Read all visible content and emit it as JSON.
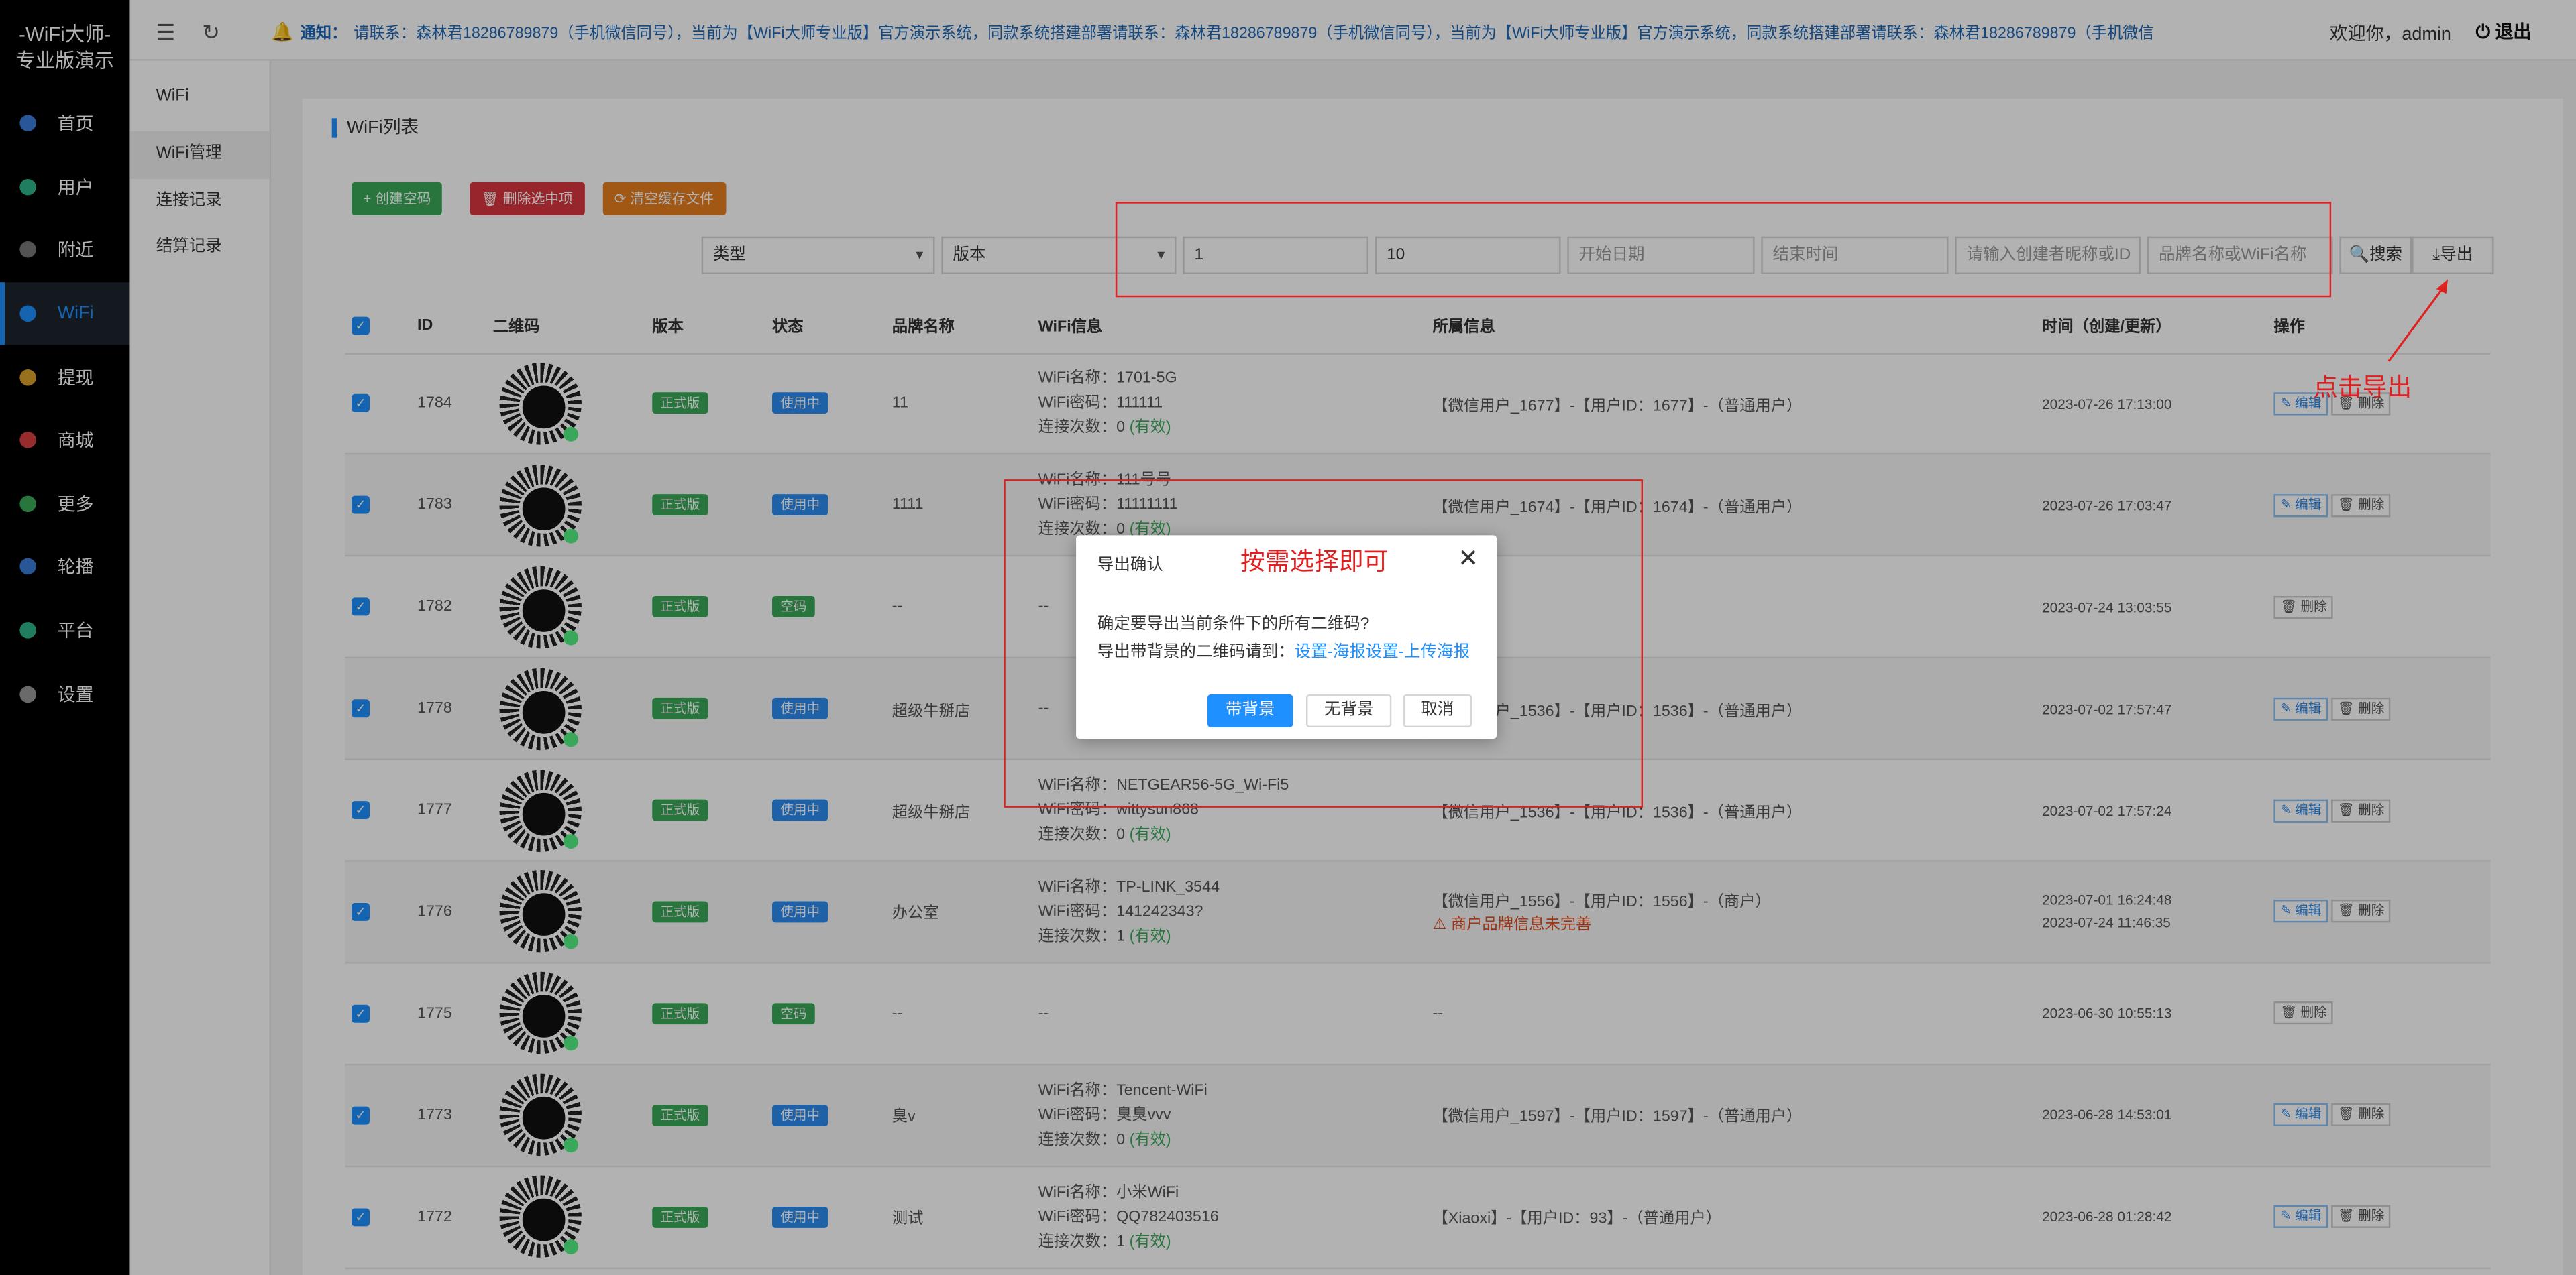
{
  "brand": {
    "line1": "-WiFi大师-",
    "line2": "专业版演示"
  },
  "sidebar": {
    "items": [
      {
        "label": "首页",
        "icon": "home-icon",
        "color": "#3b7bd8"
      },
      {
        "label": "用户",
        "icon": "user-icon",
        "color": "#2fb38a"
      },
      {
        "label": "附近",
        "icon": "location-icon",
        "color": "#777777"
      },
      {
        "label": "WiFi",
        "icon": "wifi-icon",
        "color": "#1e90ff"
      },
      {
        "label": "提现",
        "icon": "coin-icon",
        "color": "#d9a32a"
      },
      {
        "label": "商城",
        "icon": "shop-icon",
        "color": "#d94040"
      },
      {
        "label": "更多",
        "icon": "more-icon",
        "color": "#3aa85a"
      },
      {
        "label": "轮播",
        "icon": "carousel-icon",
        "color": "#3b7bd8"
      },
      {
        "label": "平台",
        "icon": "platform-icon",
        "color": "#2fb38a"
      },
      {
        "label": "设置",
        "icon": "settings-icon",
        "color": "#999999"
      }
    ]
  },
  "submenu": {
    "title": "WiFi",
    "items": [
      "WiFi管理",
      "连接记录",
      "结算记录"
    ]
  },
  "topbar": {
    "notice_label": "通知：",
    "notice_text": "请联系：森林君18286789879（手机微信同号），当前为【WiFi大师专业版】官方演示系统，同款系统搭建部署请联系：森林君18286789879（手机微信同号），当前为【WiFi大师专业版】官方演示系统，同款系统搭建部署请联系：森林君18286789879（手机微信",
    "welcome": "欢迎你，admin",
    "logout": "退出"
  },
  "page": {
    "title": "WiFi列表"
  },
  "toolbar": {
    "create": "创建空码",
    "delete": "删除选中项",
    "clear": "清空缓存文件"
  },
  "filters": {
    "type": "类型",
    "version": "版本",
    "page": "1",
    "size": "10",
    "start_date": "开始日期",
    "end_date": "结束时间",
    "creator": "请输入创建者昵称或ID",
    "brand": "品牌名称或WiFi名称",
    "search": "搜索",
    "export": "导出"
  },
  "table": {
    "headers": [
      "ID",
      "二维码",
      "版本",
      "状态",
      "品牌名称",
      "WiFi信息",
      "所属信息",
      "时间（创建/更新）",
      "操作"
    ],
    "rows": [
      {
        "id": "1784",
        "version": "正式版",
        "status": "使用中",
        "brand": "11",
        "wifi_name": "1701-5G",
        "wifi_pwd": "111111",
        "count": "0",
        "owner": "【微信用户_1677】-【用户ID：1677】-（普通用户）",
        "time1": "2023-07-26 17:13:00",
        "time2": "",
        "edit": true
      },
      {
        "id": "1783",
        "version": "正式版",
        "status": "使用中",
        "brand": "1111",
        "wifi_name": "111号号",
        "wifi_pwd": "11111111",
        "count": "0",
        "owner": "【微信用户_1674】-【用户ID：1674】-（普通用户）",
        "time1": "2023-07-26 17:03:47",
        "time2": "",
        "edit": true
      },
      {
        "id": "1782",
        "version": "正式版",
        "status": "空码",
        "brand": "--",
        "wifi_name": "",
        "wifi_pwd": "",
        "count": "",
        "owner": "",
        "time1": "2023-07-24 13:03:55",
        "time2": "",
        "edit": false
      },
      {
        "id": "1778",
        "version": "正式版",
        "status": "使用中",
        "brand": "超级牛掰店",
        "wifi_name": "",
        "wifi_pwd": "",
        "count": "",
        "owner": "【微信用户_1536】-【用户ID：1536】-（普通用户）",
        "time1": "2023-07-02 17:57:47",
        "time2": "",
        "edit": true
      },
      {
        "id": "1777",
        "version": "正式版",
        "status": "使用中",
        "brand": "超级牛掰店",
        "wifi_name": "NETGEAR56-5G_Wi-Fi5",
        "wifi_pwd": "wittysun868",
        "count": "0",
        "owner": "【微信用户_1536】-【用户ID：1536】-（普通用户）",
        "time1": "2023-07-02 17:57:24",
        "time2": "",
        "edit": true
      },
      {
        "id": "1776",
        "version": "正式版",
        "status": "使用中",
        "brand": "办公室",
        "wifi_name": "TP-LINK_3544",
        "wifi_pwd": "141242343?",
        "count": "1",
        "owner": "【微信用户_1556】-【用户ID：1556】-（商户）",
        "warn": "商户品牌信息未完善",
        "time1": "2023-07-01 16:24:48",
        "time2": "2023-07-24 11:46:35",
        "edit": true
      },
      {
        "id": "1775",
        "version": "正式版",
        "status": "空码",
        "brand": "--",
        "wifi_name": "",
        "wifi_pwd": "",
        "count": "",
        "owner": "--",
        "time1": "2023-06-30 10:55:13",
        "time2": "",
        "edit": false
      },
      {
        "id": "1773",
        "version": "正式版",
        "status": "使用中",
        "brand": "臭v",
        "wifi_name": "Tencent-WiFi",
        "wifi_pwd": "臭臭vvv",
        "count": "0",
        "owner": "【微信用户_1597】-【用户ID：1597】-（普通用户）",
        "time1": "2023-06-28 14:53:01",
        "time2": "",
        "edit": true
      },
      {
        "id": "1772",
        "version": "正式版",
        "status": "使用中",
        "brand": "测试",
        "wifi_name": "小米WiFi",
        "wifi_pwd": "QQ782403516",
        "count": "1",
        "owner": "【Xiaoxi】-【用户ID：93】-（普通用户）",
        "time1": "2023-06-28 01:28:42",
        "time2": "",
        "edit": true
      }
    ],
    "labels": {
      "name": "WiFi名称：",
      "pwd": "WiFi密码：",
      "count": "连接次数：",
      "valid": "(有效)",
      "edit": "编辑",
      "delete": "删除",
      "empty_wifi": "--"
    }
  },
  "modal": {
    "title": "导出确认",
    "line1": "确定要导出当前条件下的所有二维码?",
    "line2_prefix": "导出带背景的二维码请到：",
    "line2_link": "设置-海报设置-上传海报",
    "btn_bg": "带背景",
    "btn_nobg": "无背景",
    "btn_cancel": "取消"
  },
  "annotations": {
    "modal_hint": "按需选择即可",
    "export_hint": "点击导出"
  }
}
